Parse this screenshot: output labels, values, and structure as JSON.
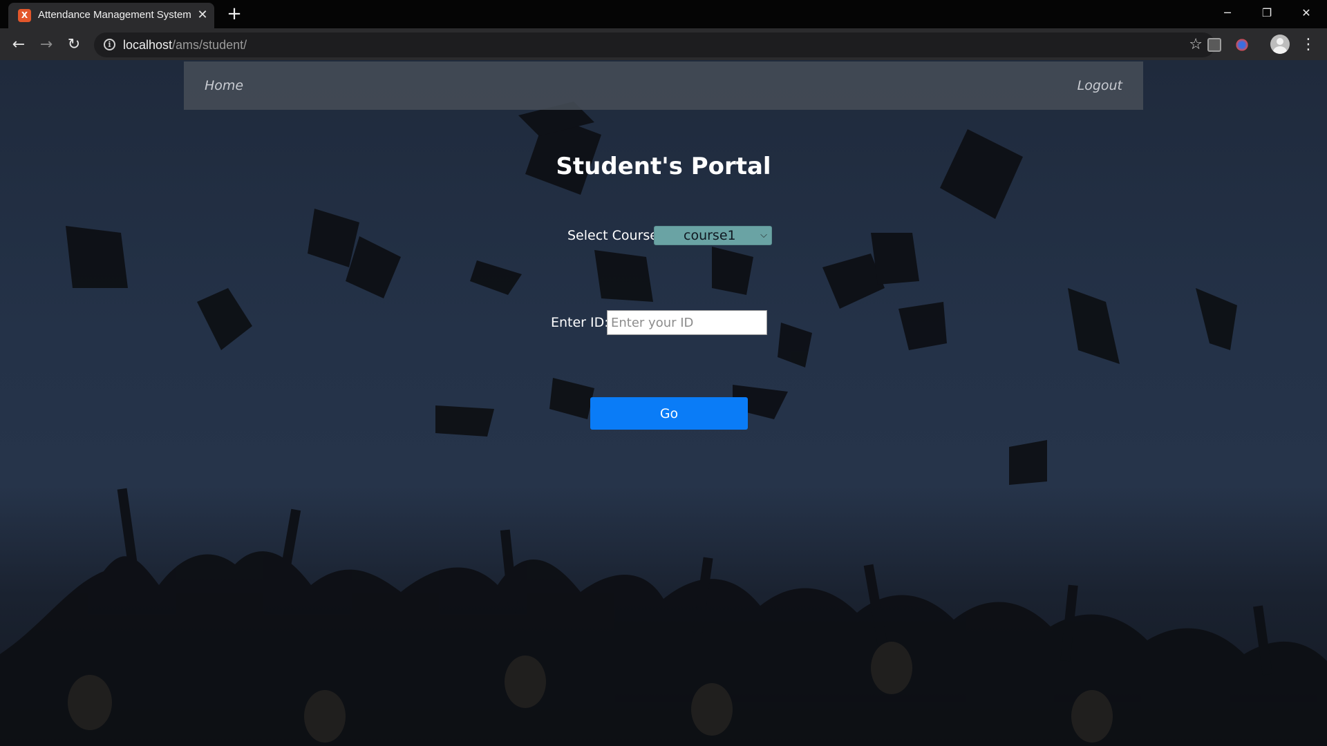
{
  "browser": {
    "tab_title": "Attendance Management System",
    "tab_favicon": "xampp-favicon-icon",
    "url_host": "localhost",
    "url_path": "/ams/student/",
    "minimize_icon": "─",
    "restore_icon": "❐",
    "close_icon": "✕"
  },
  "page": {
    "nav": {
      "home_label": "Home",
      "logout_label": "Logout"
    },
    "title": "Student's Portal",
    "course": {
      "label": "Select Course",
      "selected_value": "course1",
      "options": [
        "course1"
      ]
    },
    "student_id": {
      "label": "Enter ID:",
      "placeholder": "Enter your ID",
      "value": ""
    },
    "go_label": "Go"
  },
  "colors": {
    "navbar_bg": "#464c56",
    "select_bg": "#6aa3a4",
    "go_button_bg": "#0a7cf7",
    "tab_favicon": "#e3572b"
  }
}
